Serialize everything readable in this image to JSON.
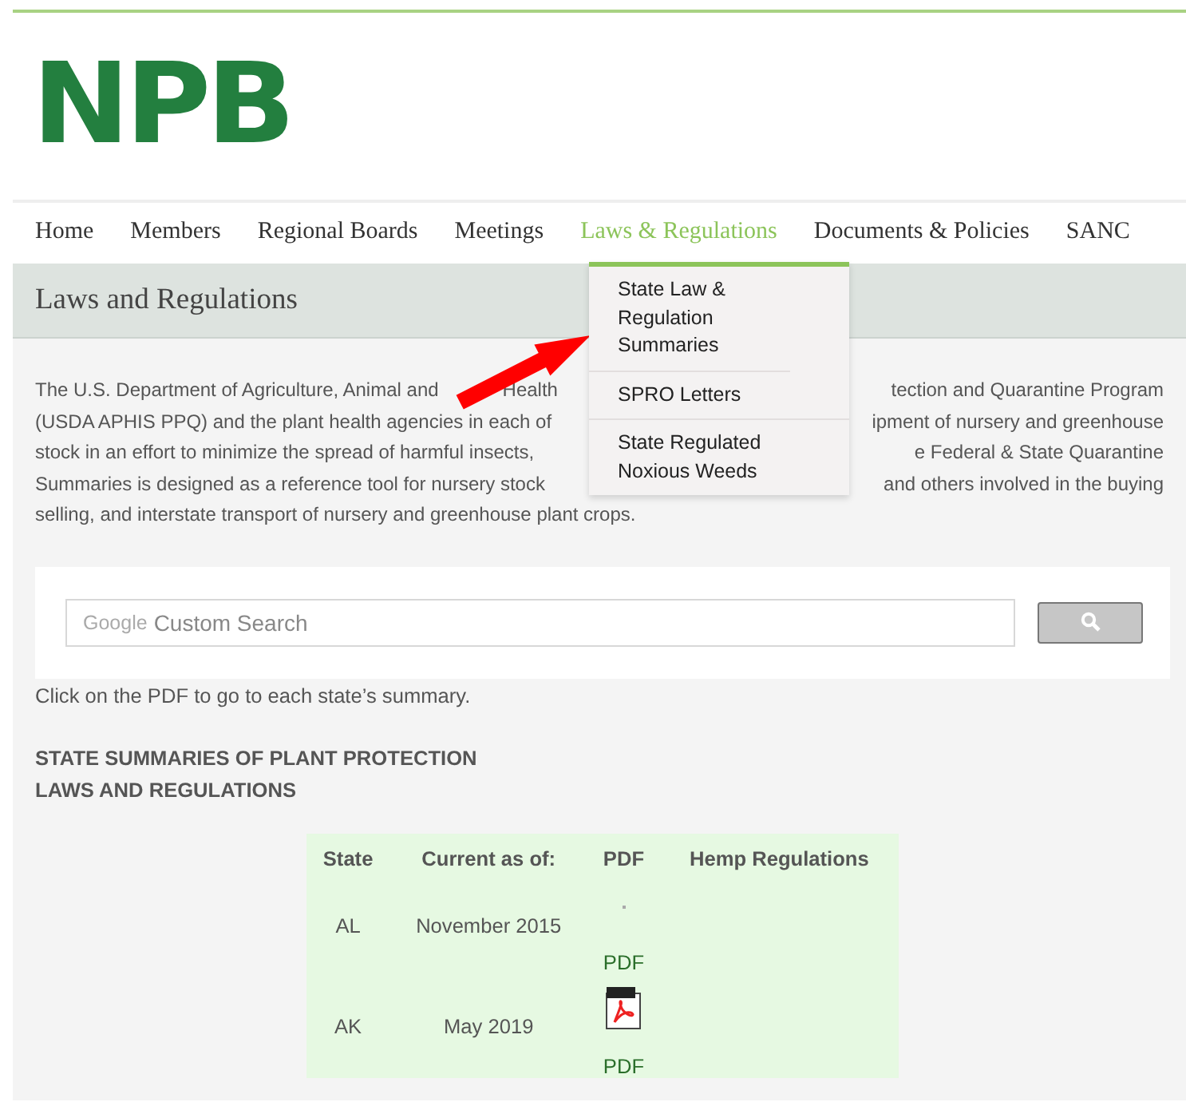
{
  "logo": {
    "text": "NPB"
  },
  "nav": [
    {
      "label": "Home",
      "selected": false
    },
    {
      "label": "Members",
      "selected": false
    },
    {
      "label": "Regional Boards",
      "selected": false
    },
    {
      "label": "Meetings",
      "selected": false
    },
    {
      "label": "Laws & Regulations",
      "selected": true
    },
    {
      "label": "Documents & Policies",
      "selected": false
    },
    {
      "label": "SANC",
      "selected": false
    }
  ],
  "dropdown": [
    "State Law & Regulation Summaries",
    "SPRO Letters",
    "State Regulated Noxious Weeds"
  ],
  "page_title": "Laws and Regulations",
  "intro_lines": [
    {
      "left": "The U.S. Department of Agriculture, Animal and",
      "middle": "Health",
      "right": "tection and Quarantine Program"
    },
    {
      "left": "(USDA APHIS PPQ) and the plant health agencies in each of",
      "right": "ipment of nursery and greenhouse"
    },
    {
      "left": "stock in an effort to minimize the spread of harmful insects,",
      "right": "e Federal & State Quarantine"
    },
    {
      "left": "Summaries is designed as a reference tool for nursery stock",
      "right": "and others involved in the buying"
    },
    {
      "left": "selling, and interstate transport of nursery and greenhouse plant crops."
    }
  ],
  "search": {
    "brand": "Google",
    "placeholder": "Custom Search"
  },
  "instruction": "Click on the PDF to go to each state’s summary.",
  "section_heading": "STATE SUMMARIES OF PLANT PROTECTION\nLAWS AND REGULATIONS",
  "table": {
    "columns": [
      "State",
      "Current as of:",
      "PDF",
      "Hemp Regulations"
    ],
    "rows": [
      {
        "state": "AL",
        "date": "November 2015",
        "pdf_icon": false,
        "pdf_link": "PDF"
      },
      {
        "state": "AK",
        "date": "May 2019",
        "pdf_icon": true,
        "pdf_link": "PDF"
      }
    ]
  }
}
